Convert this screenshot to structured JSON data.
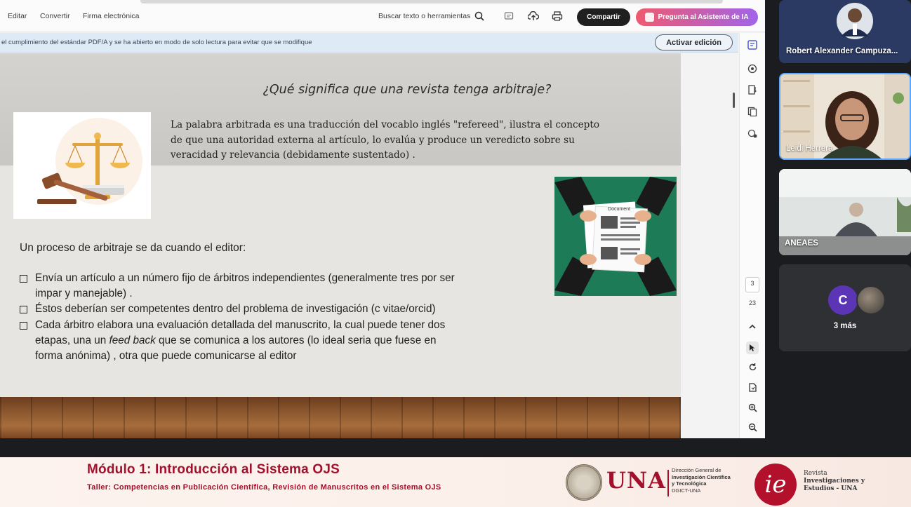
{
  "toolbar": {
    "menu": [
      "Editar",
      "Convertir",
      "Firma electrónica"
    ],
    "search_label": "Buscar texto o herramientas",
    "share_label": "Compartir",
    "ai_label": "Pregunta al Asistente de IA"
  },
  "notice": {
    "text": "el cumplimiento del estándar PDF/A y se ha abierto en modo de solo lectura para evitar que se modifique",
    "button": "Activar edición"
  },
  "rail": {
    "current_page": "3",
    "total_pages": "23"
  },
  "slide": {
    "title": "¿Qué significa que una revista tenga arbitraje?",
    "paragraph": [
      "La palabra arbitrada es una traducción del vocablo inglés \"refereed\",  ilustra el concepto",
      "de que una autoridad externa al artículo, lo evalúa y produce un veredicto sobre su",
      "veracidad y relevancia (debidamente sustentado) ."
    ],
    "doc_label": "Document",
    "process_intro": "Un proceso  de arbitraje se da cuando  el editor:",
    "bullets": [
      {
        "lines": [
          "Envía un artículo a un número fijo de árbitros independientes (generalmente tres por ser",
          "impar y manejable)  ."
        ]
      },
      {
        "lines": [
          "Éstos  deberían ser competentes dentro del problema de investigación (c vitae/orcid)"
        ]
      },
      {
        "lines": [
          "Cada árbitro elabora una evaluación detallada del manuscrito, la cual puede tener dos",
          "etapas, una un ",
          "feed back",
          " que se comunica a los autores (lo ideal seria que fuese en",
          "forma anónima) , otra que puede comunicarse  al editor"
        ]
      }
    ]
  },
  "participants": {
    "robert": "Robert Alexander Campuza...",
    "leidi": "Leidi Herrera",
    "aneaes": "ANEAES",
    "more_initial": "C",
    "more_label": "3 más"
  },
  "banner": {
    "title": "Módulo 1: Introducción al Sistema OJS",
    "subtitle": "Taller: Competencias en Publicación Científica, Revisión de Manuscritos en el Sistema OJS",
    "una": "UNA",
    "una_dir": [
      "Dirección General de",
      "Investigación Científica",
      "y Tecnológica",
      "DGICT-UNA"
    ],
    "ie": "ie",
    "ie_text": [
      "Revista",
      "Investigaciones y",
      "Estudios - UNA"
    ]
  }
}
